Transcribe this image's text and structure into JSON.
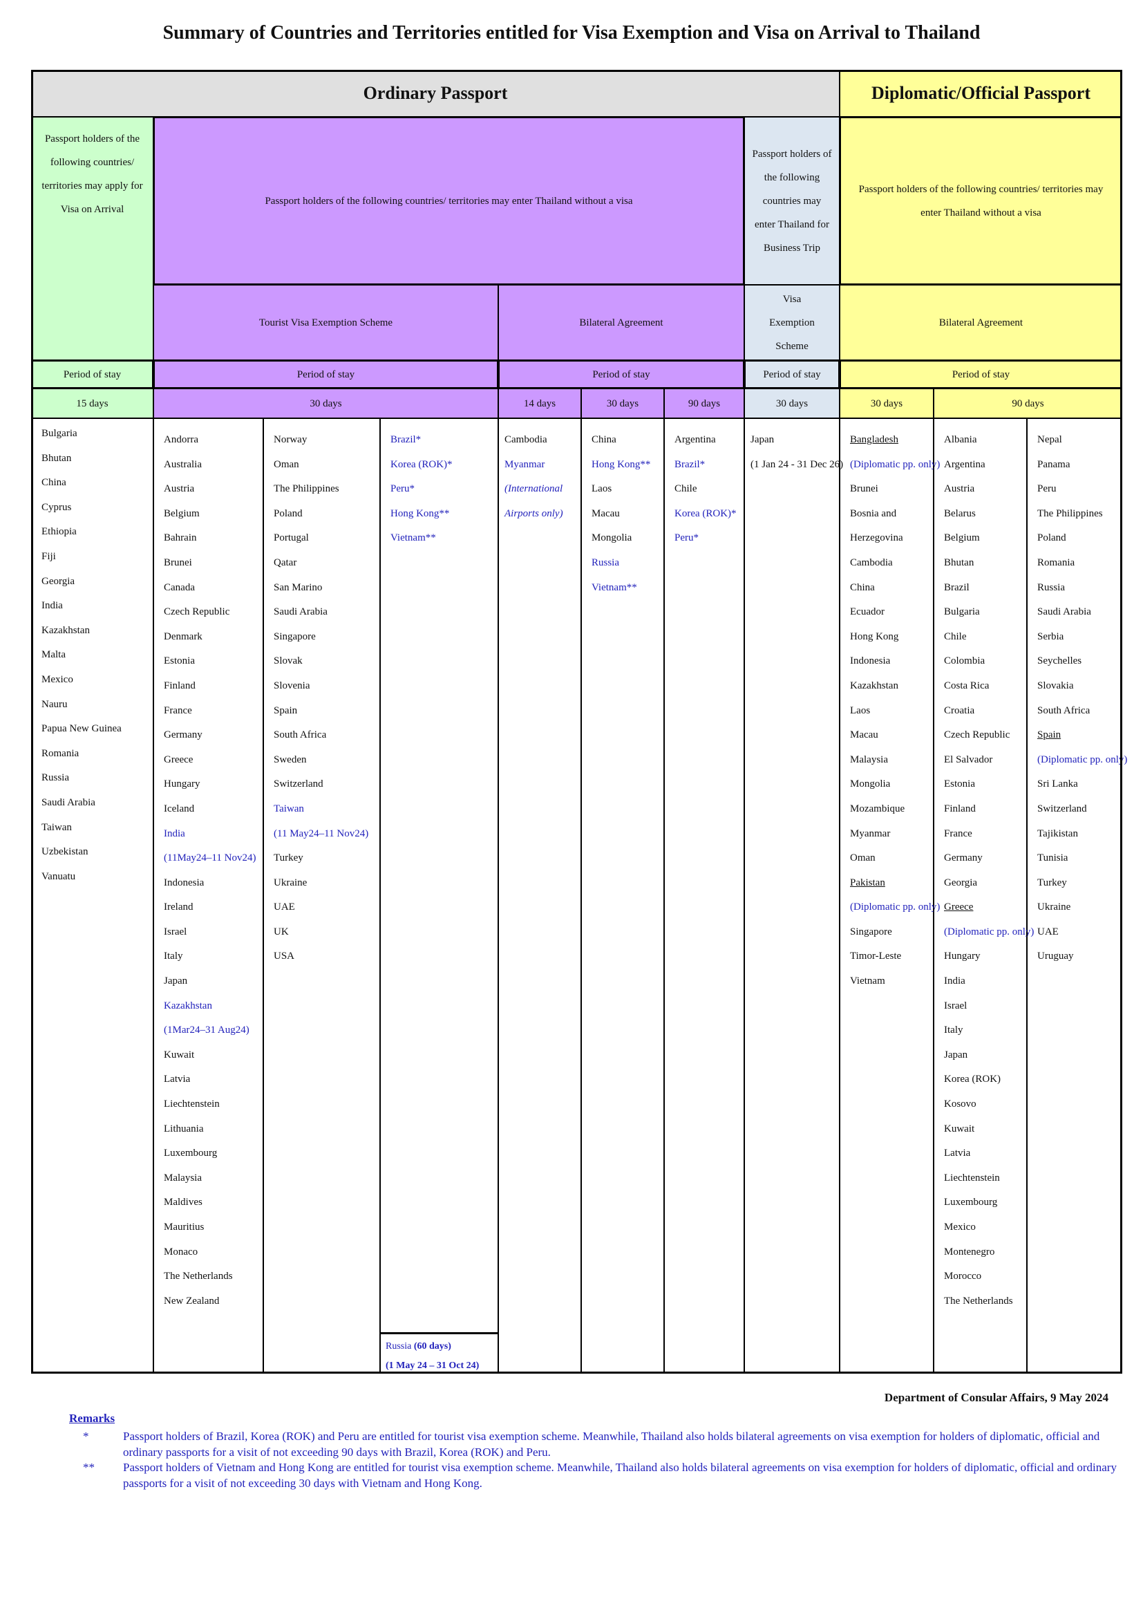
{
  "title": "Summary of Countries and Territories entitled for Visa Exemption and Visa on Arrival to Thailand",
  "headers": {
    "ordinary": "Ordinary Passport",
    "diplomatic": "Diplomatic/Official Passport",
    "voa_desc": "Passport holders of the following countries/ territories may apply for Visa on Arrival",
    "no_visa_desc": "Passport holders of the following countries/ territories may enter Thailand without a visa",
    "business_desc": "Passport holders of the following countries may enter Thailand for Business Trip",
    "dip_desc": "Passport holders of the following countries/ territories may enter Thailand without a visa",
    "tourist_scheme": "Tourist Visa Exemption Scheme",
    "bilateral": "Bilateral Agreement",
    "visa_exemption_scheme": "Visa Exemption Scheme",
    "dip_bilateral": "Bilateral Agreement",
    "period": "Period of stay",
    "days": {
      "voa": "15 days",
      "tourist": "30 days",
      "bi14": "14 days",
      "bi30": "30 days",
      "bi90": "90 days",
      "business": "30 days",
      "dip30": "30 days",
      "dip90": "90 days"
    }
  },
  "colors": {
    "voa": "#ccffcc",
    "ordinary_no_visa": "#cc99ff",
    "business": "#dce6f1",
    "diplomatic": "#ffff99",
    "ordinary_header": "#e0e0e0",
    "highlight_text": "#2222bb"
  },
  "columns": [
    {
      "id": "voa",
      "items": [
        {
          "t": "Bulgaria"
        },
        {
          "t": "Bhutan"
        },
        {
          "t": "China"
        },
        {
          "t": "Cyprus"
        },
        {
          "t": "Ethiopia"
        },
        {
          "t": "Fiji"
        },
        {
          "t": "Georgia"
        },
        {
          "t": "India"
        },
        {
          "t": "Kazakhstan"
        },
        {
          "t": "Malta"
        },
        {
          "t": "Mexico"
        },
        {
          "t": "Nauru"
        },
        {
          "t": "Papua New Guinea"
        },
        {
          "t": "Romania"
        },
        {
          "t": "Russia"
        },
        {
          "t": "Saudi Arabia"
        },
        {
          "t": "Taiwan"
        },
        {
          "t": "Uzbekistan"
        },
        {
          "t": "Vanuatu"
        }
      ]
    },
    {
      "id": "tourist-1",
      "items": [
        {
          "t": "Andorra"
        },
        {
          "t": "Australia"
        },
        {
          "t": "Austria"
        },
        {
          "t": "Belgium"
        },
        {
          "t": "Bahrain"
        },
        {
          "t": "Brunei"
        },
        {
          "t": "Canada"
        },
        {
          "t": "Czech Republic"
        },
        {
          "t": "Denmark"
        },
        {
          "t": "Estonia"
        },
        {
          "t": "Finland"
        },
        {
          "t": "France"
        },
        {
          "t": "Germany"
        },
        {
          "t": "Greece"
        },
        {
          "t": "Hungary"
        },
        {
          "t": "Iceland"
        },
        {
          "t": "India",
          "s": "blue"
        },
        {
          "t": "(11May24–11 Nov24)",
          "s": "blue"
        },
        {
          "t": "Indonesia"
        },
        {
          "t": "Ireland"
        },
        {
          "t": "Israel"
        },
        {
          "t": "Italy"
        },
        {
          "t": "Japan"
        },
        {
          "t": "Kazakhstan",
          "s": "blue"
        },
        {
          "t": "(1Mar24–31 Aug24)",
          "s": "blue"
        },
        {
          "t": "Kuwait"
        },
        {
          "t": "Latvia"
        },
        {
          "t": "Liechtenstein"
        },
        {
          "t": "Lithuania"
        },
        {
          "t": "Luxembourg"
        },
        {
          "t": "Malaysia"
        },
        {
          "t": "Maldives"
        },
        {
          "t": "Mauritius"
        },
        {
          "t": "Monaco"
        },
        {
          "t": "The Netherlands"
        },
        {
          "t": "New Zealand"
        }
      ]
    },
    {
      "id": "tourist-2",
      "items": [
        {
          "t": "Norway"
        },
        {
          "t": "Oman"
        },
        {
          "t": "The Philippines"
        },
        {
          "t": "Poland"
        },
        {
          "t": "Portugal"
        },
        {
          "t": "Qatar"
        },
        {
          "t": "San Marino"
        },
        {
          "t": "Saudi Arabia"
        },
        {
          "t": "Singapore"
        },
        {
          "t": "Slovak"
        },
        {
          "t": "Slovenia"
        },
        {
          "t": "Spain"
        },
        {
          "t": "South Africa"
        },
        {
          "t": "Sweden"
        },
        {
          "t": "Switzerland"
        },
        {
          "t": "Taiwan",
          "s": "blue"
        },
        {
          "t": "(11 May24–11 Nov24)",
          "s": "blue"
        },
        {
          "t": "Turkey"
        },
        {
          "t": "Ukraine"
        },
        {
          "t": "UAE"
        },
        {
          "t": "UK"
        },
        {
          "t": "USA"
        }
      ]
    },
    {
      "id": "tourist-3",
      "items": [
        {
          "t": "Brazil*",
          "s": "blue"
        },
        {
          "t": "Korea (ROK)*",
          "s": "blue"
        },
        {
          "t": "Peru*",
          "s": "blue"
        },
        {
          "t": "Hong Kong**",
          "s": "blue"
        },
        {
          "t": "Vietnam**",
          "s": "blue"
        }
      ]
    },
    {
      "id": "bilateral-14",
      "items": [
        {
          "t": "Cambodia"
        },
        {
          "t": "Myanmar",
          "s": "blue"
        },
        {
          "t": "(International",
          "s": "blue it-i"
        },
        {
          "t": "Airports only)",
          "s": "blue it-i"
        }
      ]
    },
    {
      "id": "bilateral-30",
      "items": [
        {
          "t": "China"
        },
        {
          "t": "Hong Kong**",
          "s": "blue"
        },
        {
          "t": "Laos"
        },
        {
          "t": "Macau"
        },
        {
          "t": "Mongolia"
        },
        {
          "t": "Russia",
          "s": "blue"
        },
        {
          "t": "Vietnam**",
          "s": "blue"
        }
      ]
    },
    {
      "id": "bilateral-90",
      "items": [
        {
          "t": "Argentina"
        },
        {
          "t": "Brazil*",
          "s": "blue"
        },
        {
          "t": "Chile"
        },
        {
          "t": "Korea (ROK)*",
          "s": "blue"
        },
        {
          "t": "Peru*",
          "s": "blue"
        }
      ]
    },
    {
      "id": "business",
      "items": [
        {
          "t": "Japan"
        },
        {
          "t": "(1 Jan 24 - 31 Dec 26)"
        }
      ]
    },
    {
      "id": "dip-30",
      "items": [
        {
          "t": "Bangladesh",
          "s": "ul"
        },
        {
          "t": "(Diplomatic pp. only)",
          "s": "blue"
        },
        {
          "t": "Brunei"
        },
        {
          "t": "Bosnia and"
        },
        {
          "t": "Herzegovina"
        },
        {
          "t": "Cambodia"
        },
        {
          "t": "China"
        },
        {
          "t": "Ecuador"
        },
        {
          "t": "Hong Kong"
        },
        {
          "t": "Indonesia"
        },
        {
          "t": "Kazakhstan"
        },
        {
          "t": "Laos"
        },
        {
          "t": "Macau"
        },
        {
          "t": "Malaysia"
        },
        {
          "t": "Mongolia"
        },
        {
          "t": "Mozambique"
        },
        {
          "t": "Myanmar"
        },
        {
          "t": "Oman"
        },
        {
          "t": "Pakistan",
          "s": "ul"
        },
        {
          "t": "(Diplomatic pp. only)",
          "s": "blue"
        },
        {
          "t": "Singapore"
        },
        {
          "t": "Timor-Leste"
        },
        {
          "t": "Vietnam"
        }
      ]
    },
    {
      "id": "dip-90-1",
      "items": [
        {
          "t": "Albania"
        },
        {
          "t": "Argentina"
        },
        {
          "t": "Austria"
        },
        {
          "t": "Belarus"
        },
        {
          "t": "Belgium"
        },
        {
          "t": "Bhutan"
        },
        {
          "t": "Brazil"
        },
        {
          "t": "Bulgaria"
        },
        {
          "t": "Chile"
        },
        {
          "t": "Colombia"
        },
        {
          "t": "Costa Rica"
        },
        {
          "t": "Croatia"
        },
        {
          "t": "Czech Republic"
        },
        {
          "t": "El Salvador"
        },
        {
          "t": "Estonia"
        },
        {
          "t": "Finland"
        },
        {
          "t": "France"
        },
        {
          "t": "Germany"
        },
        {
          "t": "Georgia"
        },
        {
          "t": "Greece",
          "s": "ul"
        },
        {
          "t": "(Diplomatic pp. only)",
          "s": "blue"
        },
        {
          "t": "Hungary"
        },
        {
          "t": "India"
        },
        {
          "t": "Israel"
        },
        {
          "t": "Italy"
        },
        {
          "t": "Japan"
        },
        {
          "t": "Korea (ROK)"
        },
        {
          "t": "Kosovo"
        },
        {
          "t": "Kuwait"
        },
        {
          "t": "Latvia"
        },
        {
          "t": "Liechtenstein"
        },
        {
          "t": "Luxembourg"
        },
        {
          "t": "Mexico"
        },
        {
          "t": "Montenegro"
        },
        {
          "t": "Morocco"
        },
        {
          "t": "The Netherlands"
        }
      ]
    },
    {
      "id": "dip-90-2",
      "items": [
        {
          "t": "Nepal"
        },
        {
          "t": "Panama"
        },
        {
          "t": "Peru"
        },
        {
          "t": "The Philippines"
        },
        {
          "t": "Poland"
        },
        {
          "t": "Romania"
        },
        {
          "t": "Russia"
        },
        {
          "t": "Saudi Arabia"
        },
        {
          "t": "Serbia"
        },
        {
          "t": "Seychelles"
        },
        {
          "t": "Slovakia"
        },
        {
          "t": "South Africa"
        },
        {
          "t": "Spain",
          "s": "ul"
        },
        {
          "t": "(Diplomatic pp. only)",
          "s": "blue"
        },
        {
          "t": "Sri Lanka"
        },
        {
          "t": "Switzerland"
        },
        {
          "t": "Tajikistan"
        },
        {
          "t": "Tunisia"
        },
        {
          "t": "Turkey"
        },
        {
          "t": "Ukraine"
        },
        {
          "t": "UAE"
        },
        {
          "t": "Uruguay"
        }
      ]
    }
  ],
  "russia_note": {
    "country": "Russia",
    "days": "(60 days)",
    "period": "(1 May 24 – 31 Oct 24)"
  },
  "footer": {
    "department": "Department of Consular Affairs, 9 May 2024"
  },
  "remarks": {
    "heading": "Remarks",
    "items": [
      {
        "mark": "*",
        "text": "Passport holders of Brazil, Korea (ROK) and Peru are entitled for tourist visa exemption scheme. Meanwhile, Thailand also holds bilateral agreements on visa exemption for holders of diplomatic, official and ordinary passports for a visit of not exceeding 90 days with Brazil, Korea (ROK) and Peru."
      },
      {
        "mark": "**",
        "text": "Passport holders of Vietnam and Hong Kong are entitled for tourist visa exemption scheme. Meanwhile, Thailand also holds bilateral agreements on visa exemption for holders of diplomatic, official and ordinary passports for a visit of not exceeding 30 days with Vietnam and Hong Kong."
      }
    ]
  }
}
